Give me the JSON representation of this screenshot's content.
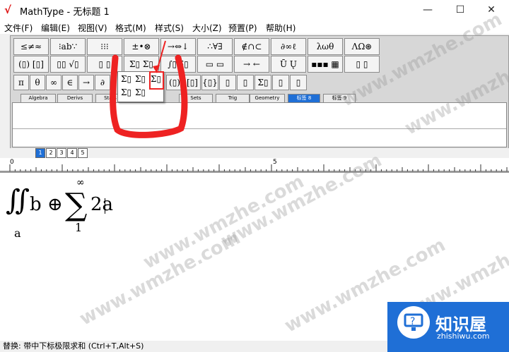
{
  "window": {
    "title": "MathType - 无标题 1",
    "minimize": "—",
    "maximize": "☐",
    "close": "✕"
  },
  "menu": [
    "文件(F)",
    "编辑(E)",
    "视图(V)",
    "格式(M)",
    "样式(S)",
    "大小(Z)",
    "预置(P)",
    "帮助(H)"
  ],
  "palette_row1": [
    "≤≠≈",
    "⁝ab∵",
    "⁝⁝⁝",
    "±•⊗",
    "→⇔↓",
    "∴∀∃",
    "∉∩⊂",
    "∂∞ℓ",
    "λωθ",
    "ΛΩ⊛"
  ],
  "palette_row2": [
    "(▯) [▯]",
    "▯▯ √▯",
    "▯ ▯",
    "Σ▯ Σ▯",
    "∫▯ ∮▯",
    "▭ ▭",
    "→ ←",
    "Ū Ų",
    "▪▪▪ ▦",
    "▯ ▯"
  ],
  "palette_row3": [
    "π",
    "θ",
    "∞",
    "∈",
    "→",
    "∂",
    "(▯)",
    "[▯]",
    "{▯}",
    "▯",
    "▯",
    "Σ▯",
    "▯",
    "▯"
  ],
  "tabs": [
    "Algebra",
    "Derivs",
    "Stats",
    "Sets",
    "Trig",
    "Geometry",
    "标签 8",
    "标签 9"
  ],
  "dropdown": {
    "items": [
      "Σ▯",
      "Σ▯",
      "Σ▯",
      "Σ▯",
      "Σ▯"
    ]
  },
  "tab_buttons": [
    "1",
    "2",
    "3",
    "4",
    "5"
  ],
  "ruler": {
    "marks": [
      "0",
      "5"
    ]
  },
  "equation": {
    "integral": "∬",
    "integral_sub": "a",
    "term1": "b ⊕",
    "sum": "∑",
    "sum_upper": "∞",
    "sum_lower": "1",
    "term2": "2a"
  },
  "watermarks": [
    "www.wmzhe.com",
    "www.wmzhe.com",
    "www.wmzhe.com",
    "www.wmzhe.com",
    "www.wmzhe.com",
    "www.wmzhe.com",
    "www.wmzhe.com"
  ],
  "status": "替换: 带中下标极限求和 (Ctrl+T,Alt+S)",
  "logo": {
    "cn": "知识屋",
    "en": "zhishiwu.com"
  },
  "colors": {
    "accent": "#1f6fd6",
    "annotation": "#e22222"
  }
}
